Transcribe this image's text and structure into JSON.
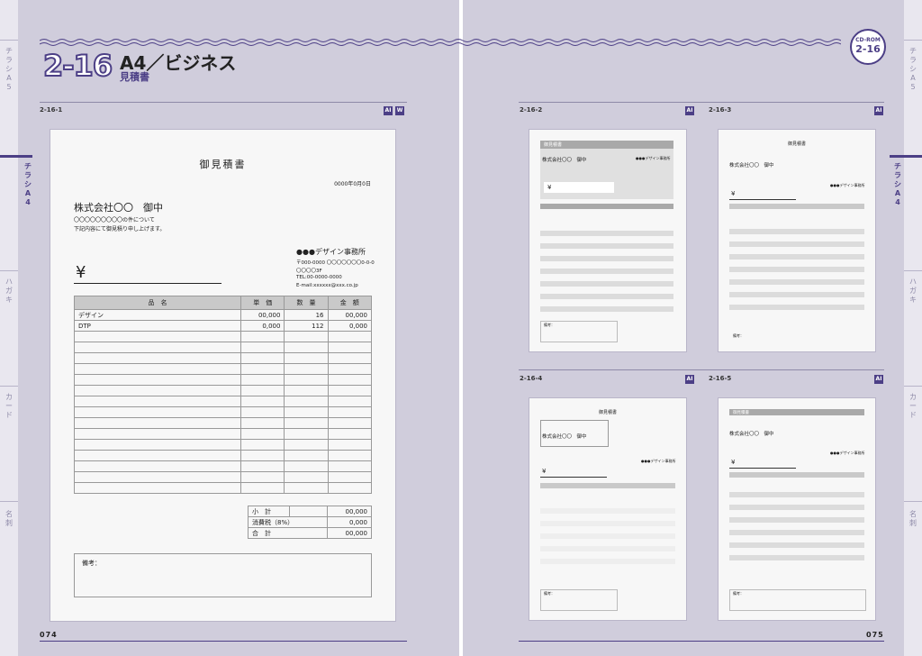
{
  "header": {
    "section_number": "2-16",
    "title": "A4／ビジネス",
    "subtitle": "見積書",
    "cd_label": "CD-ROM",
    "cd_number": "2-16"
  },
  "side_tabs_left": [
    "チラシA5",
    "チラシA4",
    "ハガキ",
    "カード",
    "名刺"
  ],
  "side_tabs_right": [
    "チラシA5",
    "チラシA4",
    "ハガキ",
    "カード",
    "名刺"
  ],
  "items": [
    {
      "id": "2-16-1",
      "badges": [
        "AI",
        "W"
      ]
    },
    {
      "id": "2-16-2",
      "badges": [
        "AI"
      ]
    },
    {
      "id": "2-16-3",
      "badges": [
        "AI"
      ]
    },
    {
      "id": "2-16-4",
      "badges": [
        "AI"
      ]
    },
    {
      "id": "2-16-5",
      "badges": [
        "AI"
      ]
    }
  ],
  "page_numbers": {
    "left": "074",
    "right": "075"
  },
  "estimate": {
    "title": "御見積書",
    "date": "0000年0月0日",
    "client": "株式会社〇〇　御中",
    "note_line1": "〇〇〇〇〇〇〇〇〇の件について",
    "note_line2": "下記内容にて御見積り申し上げます。",
    "yen": "¥",
    "company": "●●●デザイン事務所",
    "address1": "〒000-0000 〇〇〇〇〇〇〇0-0-0",
    "address2": "〇〇〇〇3F",
    "tel": "TEL:00-0000-0000",
    "email": "E-mail:xxxxxx@xxx.co.jp",
    "columns": [
      "品　名",
      "単　価",
      "数　量",
      "金　額"
    ],
    "rows": [
      {
        "name": "デザイン",
        "price": "00,000",
        "qty": "16",
        "amount": "00,000"
      },
      {
        "name": "DTP",
        "price": "0,000",
        "qty": "112",
        "amount": "0,000"
      }
    ],
    "subtotal_label": "小　計",
    "subtotal": "00,000",
    "tax_label": "消費税（8%）",
    "tax": "0,000",
    "total_label": "合　計",
    "total": "00,000",
    "remarks_label": "備考："
  },
  "mini": {
    "title": "御見積書",
    "client": "株式会社〇〇　御中",
    "yen": "¥",
    "company": "●●●デザイン事務所",
    "remarks": "備考："
  }
}
